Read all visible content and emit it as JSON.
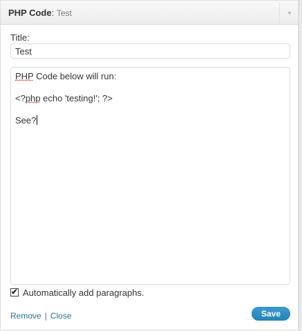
{
  "widget": {
    "name": "PHP Code",
    "name_suffix": ": ",
    "instance_title": "Test",
    "toggle_icon": "triangle-down-icon"
  },
  "form": {
    "title_label": "Title:",
    "title_value": "Test",
    "body_lines": {
      "line1_word": "PHP",
      "line1_rest": " Code below will run:",
      "line2_pre": "<?",
      "line2_word": "php",
      "line2_rest": " echo 'testing!'; ?>",
      "line3": "See?"
    },
    "auto_paragraphs_label": "Automatically add paragraphs.",
    "auto_paragraphs_checked": true
  },
  "actions": {
    "remove_label": "Remove",
    "separator": "|",
    "close_label": "Close",
    "save_label": "Save"
  },
  "colors": {
    "link": "#21759b",
    "save_button": "#2483b3"
  }
}
